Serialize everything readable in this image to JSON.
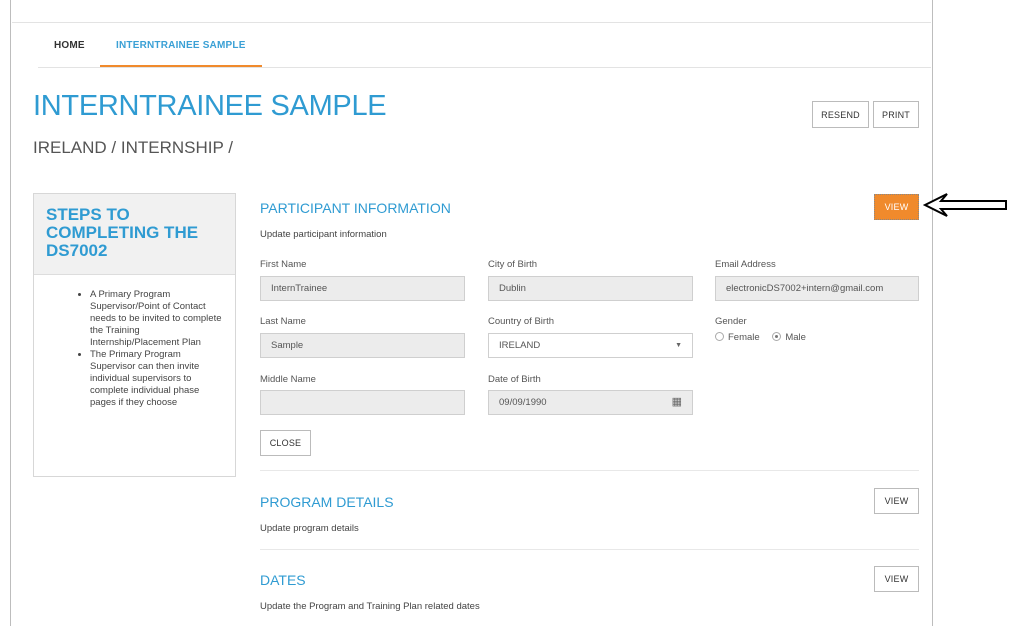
{
  "tabs": {
    "home": "HOME",
    "active": "INTERNTRAINEE SAMPLE"
  },
  "page": {
    "title": "INTERNTRAINEE SAMPLE",
    "breadcrumb": "IRELAND / INTERNSHIP /"
  },
  "actions": {
    "resend": "RESEND",
    "print": "PRINT"
  },
  "sidebar": {
    "title": "STEPS TO COMPLETING THE DS7002",
    "items": [
      "A Primary Program Supervisor/Point of Contact needs to be invited to complete the Training Internship/Placement Plan",
      "The Primary Program Supervisor can then invite individual supervisors to complete individual phase pages if they choose"
    ]
  },
  "participant": {
    "title": "PARTICIPANT INFORMATION",
    "desc": "Update participant information",
    "view": "VIEW",
    "first_name": {
      "label": "First Name",
      "value": "InternTrainee"
    },
    "last_name": {
      "label": "Last Name",
      "value": "Sample"
    },
    "middle_name": {
      "label": "Middle Name",
      "value": ""
    },
    "city": {
      "label": "City of Birth",
      "value": "Dublin"
    },
    "country": {
      "label": "Country of Birth",
      "value": "IRELAND"
    },
    "dob": {
      "label": "Date of Birth",
      "value": "09/09/1990"
    },
    "email": {
      "label": "Email Address",
      "value": "electronicDS7002+intern@gmail.com"
    },
    "gender": {
      "label": "Gender",
      "female": "Female",
      "male": "Male",
      "selected": "Male"
    },
    "close": "CLOSE"
  },
  "program": {
    "title": "PROGRAM DETAILS",
    "desc": "Update program details",
    "view": "VIEW"
  },
  "dates": {
    "title": "DATES",
    "desc": "Update the Program and Training Plan related dates",
    "view": "VIEW"
  },
  "colors": {
    "accent_blue": "#2f9bd2",
    "accent_orange": "#f08a2c"
  }
}
